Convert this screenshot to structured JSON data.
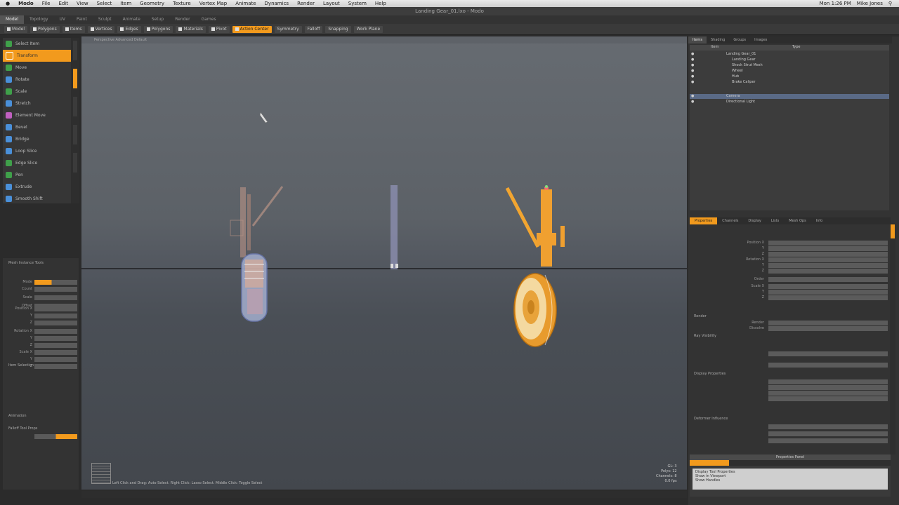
{
  "menubar": {
    "apple": "",
    "items": [
      "Modo",
      "File",
      "Edit",
      "View",
      "Select",
      "Item",
      "Geometry",
      "Texture",
      "Vertex Map",
      "Animate",
      "Dynamics",
      "Render",
      "Layout",
      "System",
      "Help"
    ],
    "right_status": [
      "Mon 1:26 PM",
      "Mike Jones"
    ]
  },
  "window": {
    "title": "Landing Gear_01.lxo - Modo"
  },
  "layout_tabs": [
    "Model",
    "Topology",
    "UV",
    "Paint",
    "Sculpt",
    "Animate",
    "Setup",
    "Render",
    "Games"
  ],
  "toolbar": {
    "buttons": [
      "Model",
      "Polygons",
      "Items",
      "Vertices",
      "Edges",
      "Polygons",
      "Materials",
      "Pivot",
      "Action Center",
      "Symmetry",
      "Falloff",
      "Snapping",
      "Work Plane"
    ],
    "active_index": 8
  },
  "tools": {
    "items": [
      {
        "label": "Select Item",
        "color": "#3fa04a"
      },
      {
        "label": "Transform",
        "color": "#f29a1d"
      },
      {
        "label": "Move",
        "color": "#3fa04a"
      },
      {
        "label": "Rotate",
        "color": "#4a90d9"
      },
      {
        "label": "Scale",
        "color": "#3fa04a"
      },
      {
        "label": "Stretch",
        "color": "#4a90d9"
      },
      {
        "label": "Element Move",
        "color": "#c060c0"
      },
      {
        "label": "Bevel",
        "color": "#4a90d9"
      },
      {
        "label": "Bridge",
        "color": "#4a90d9"
      },
      {
        "label": "Loop Slice",
        "color": "#4a90d9"
      },
      {
        "label": "Edge Slice",
        "color": "#3fa04a"
      },
      {
        "label": "Pen",
        "color": "#3fa04a"
      },
      {
        "label": "Extrude",
        "color": "#4a90d9"
      },
      {
        "label": "Smooth Shift",
        "color": "#4a90d9"
      }
    ],
    "active_index": 1
  },
  "props": {
    "title": "Mesh Instance Tools",
    "rows": [
      "Mode",
      "Count",
      "Scale",
      "Offset",
      "Position X",
      "Y",
      "Z",
      "Rotation X",
      "Y",
      "Z",
      "Scale X",
      "Y",
      "Z"
    ],
    "section2": "Item Selection",
    "section3": "Animation",
    "section4": "Falloff Tool Props"
  },
  "viewport": {
    "header": "Perspective   Advanced   Default",
    "status": "Left Click and Drag: Auto Select. Right Click: Lasso Select. Middle Click: Toggle Select",
    "readout": [
      "GL: 3",
      "Polys: 12",
      "Channels: 8",
      "0.0 fps"
    ]
  },
  "right_tabs": [
    "Items",
    "Shading",
    "Groups",
    "Images"
  ],
  "scene": {
    "header": [
      "Item",
      "Type"
    ],
    "rows": [
      "Landing Gear_01",
      "Landing Gear",
      "Shock Strut Mesh",
      "Wheel",
      "Hub",
      "Brake Caliper",
      "Camera",
      "Directional Light"
    ],
    "selected_index": 6
  },
  "properties": {
    "tabs": [
      "Properties",
      "Channels",
      "Display",
      "Lists",
      "Mesh Ops",
      "Info"
    ],
    "active_tab": 0,
    "rows": [
      "Position X",
      "Y",
      "Z",
      "Rotation X",
      "Y",
      "Z",
      "Order",
      "Scale X",
      "Y",
      "Z"
    ],
    "section2": "Render",
    "section2_rows": [
      "Render",
      "Dissolve"
    ],
    "section3": "Ray Visibility",
    "section4": "Display Properties",
    "section5": "Deformer Influence"
  },
  "bottom_panel": {
    "title": "Properties Panel",
    "text1": "Display Tool Properties",
    "text2": "Show in Viewport",
    "text3": "Show Handles"
  },
  "statusbar": ""
}
